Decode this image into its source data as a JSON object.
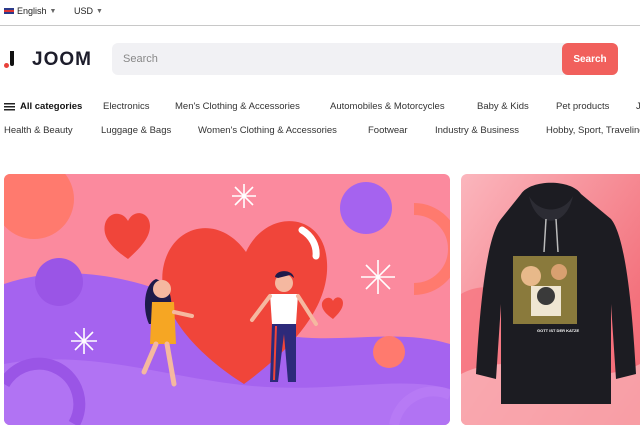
{
  "topbar": {
    "language": "English",
    "currency": "USD"
  },
  "header": {
    "logo_text": "JOOM",
    "search": {
      "placeholder": "Search",
      "button_label": "Search"
    }
  },
  "categories": {
    "all_label": "All categories",
    "row1": [
      "Electronics",
      "Men's Clothing & Accessories",
      "Automobiles & Motorcycles",
      "Baby & Kids",
      "Pet products",
      "J"
    ],
    "row2": [
      "Health & Beauty",
      "Luggage & Bags",
      "Women's Clothing & Accessories",
      "Footwear",
      "Industry & Business",
      "Hobby, Sport, Traveling"
    ]
  },
  "banners": {
    "hoodie_print_text": "GOTT IST DER KATZE"
  },
  "colors": {
    "accent": "#f1605c",
    "banner_pink": "#fb8a9e",
    "banner_purple": "#a563ef",
    "heart_red": "#f0453a"
  }
}
